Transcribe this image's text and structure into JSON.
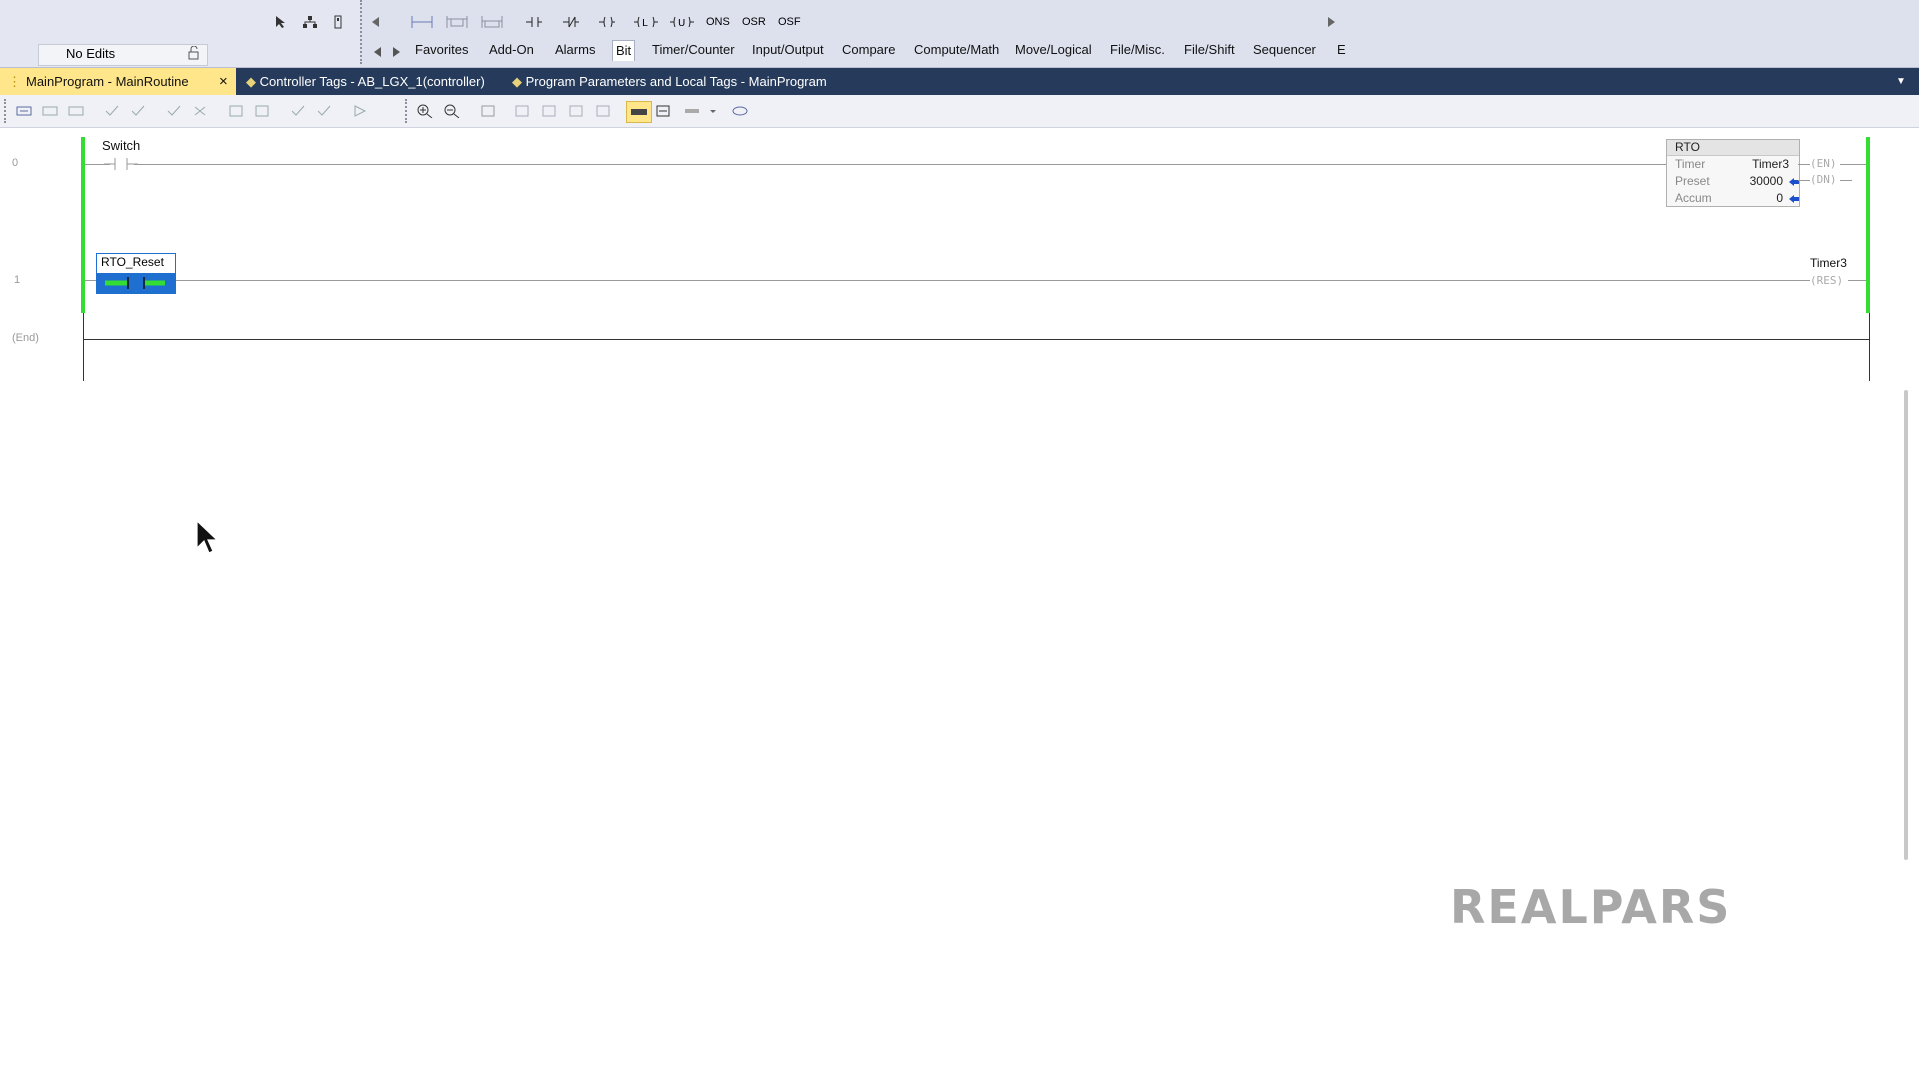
{
  "toolbar": {
    "edits_status": "No Edits",
    "ladder_elements": [
      "ONS",
      "OSR",
      "OSF"
    ],
    "categories": [
      "Favorites",
      "Add-On",
      "Alarms",
      "Bit",
      "Timer/Counter",
      "Input/Output",
      "Compare",
      "Compute/Math",
      "Move/Logical",
      "File/Misc.",
      "File/Shift",
      "Sequencer",
      "E"
    ],
    "active_category": "Bit"
  },
  "tabs": [
    {
      "label": "MainProgram - MainRoutine",
      "close": "×"
    },
    {
      "label": "Controller Tags - AB_LGX_1(controller)"
    },
    {
      "label": "Program Parameters and Local Tags - MainProgram"
    }
  ],
  "ladder": {
    "rungs": [
      {
        "number": "0",
        "contact_tag": "Switch"
      },
      {
        "number": "1",
        "contact_tag": "RTO_Reset",
        "coil_tag": "Timer3",
        "coil_type": "RES"
      }
    ],
    "end_label": "(End)",
    "rto": {
      "title": "RTO",
      "timer_label": "Timer",
      "timer_value": "Timer3",
      "preset_label": "Preset",
      "preset_value": "30000",
      "accum_label": "Accum",
      "accum_value": "0",
      "en": "EN",
      "dn": "DN"
    }
  },
  "watermark": "REALPARS",
  "colors": {
    "rail": "#33dd33",
    "tab_active": "#ffe68a",
    "tabbar": "#263b5c",
    "selected_instruction": "#1e6fd0"
  }
}
